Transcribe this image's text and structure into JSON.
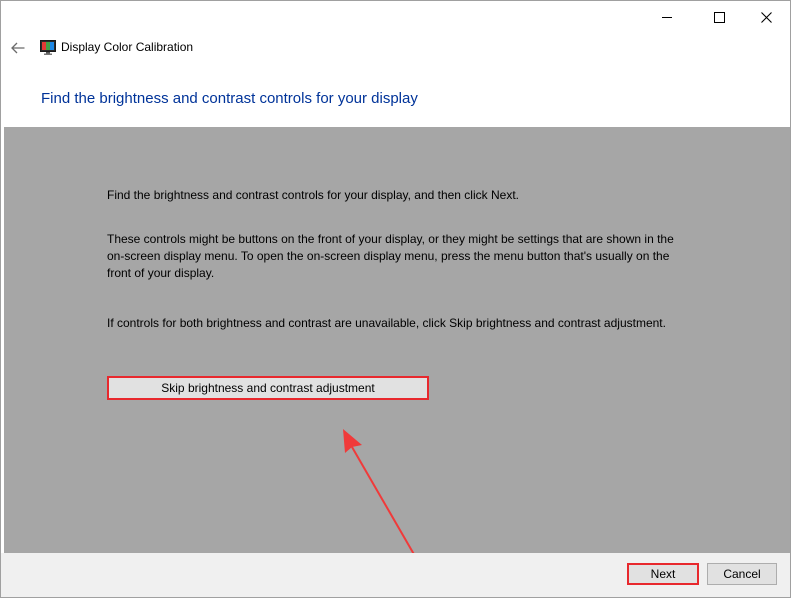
{
  "window": {
    "title": "Display Color Calibration",
    "controls": [
      "minimize",
      "maximize",
      "close"
    ]
  },
  "nav": {
    "back_icon": "back-arrow-icon",
    "app_icon": "display-calibration-icon"
  },
  "page": {
    "heading": "Find the brightness and contrast controls for your display",
    "paragraphs": [
      "Find the brightness and contrast controls for your display, and then click Next.",
      "These controls might be buttons on the front of your display, or they might be settings that are shown in the on-screen display menu. To open the on-screen display menu, press the menu button that's usually on the front of your display.",
      "If controls for both brightness and contrast are unavailable, click Skip brightness and contrast adjustment."
    ],
    "skip_button": "Skip brightness and contrast adjustment"
  },
  "footer": {
    "next_label": "Next",
    "cancel_label": "Cancel"
  },
  "colors": {
    "heading": "#003399",
    "content_bg": "#a6a6a6",
    "highlight": "#e8282d"
  }
}
